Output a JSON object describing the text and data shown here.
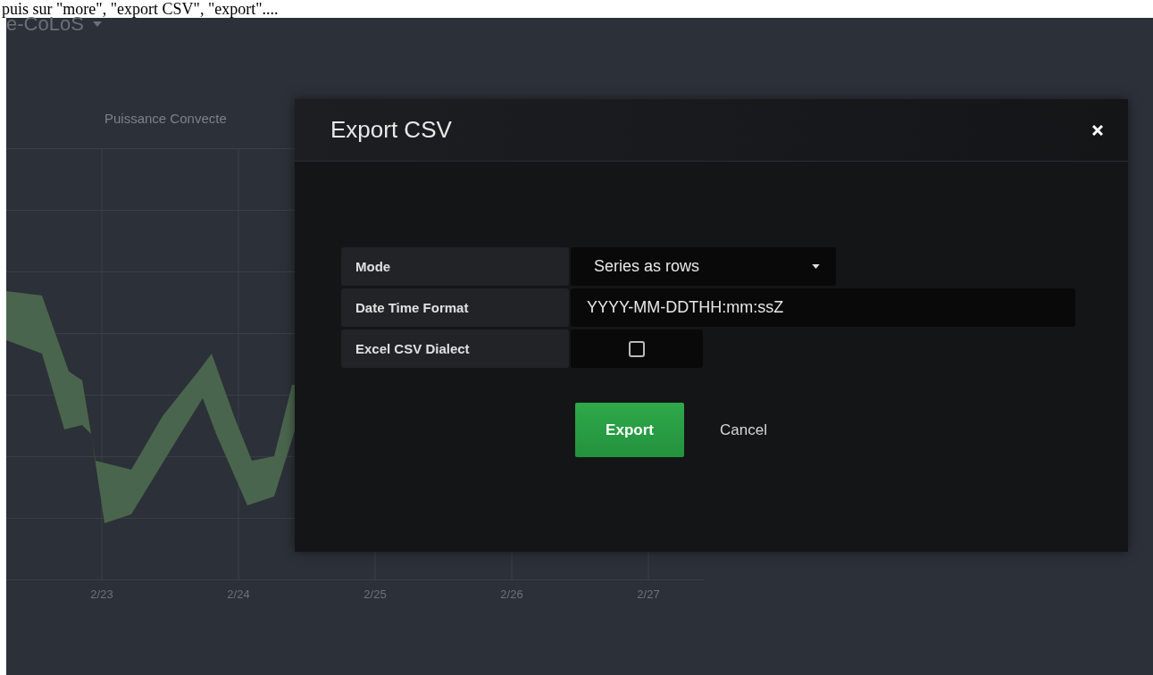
{
  "top_caption": "puis sur \"more\", \"export CSV\", \"export\"....",
  "dashboard": {
    "title": "e-CoLoS"
  },
  "panel": {
    "title": "Puissance Convecte",
    "x_labels": [
      "2/23",
      "2/24",
      "2/25",
      "2/26",
      "2/27"
    ]
  },
  "modal": {
    "title": "Export CSV",
    "fields": [
      {
        "kind": "select",
        "label": "Mode",
        "value": "Series as rows"
      },
      {
        "kind": "text",
        "label": "Date Time Format",
        "value": "YYYY-MM-DDTHH:mm:ssZ"
      },
      {
        "kind": "checkbox",
        "label": "Excel CSV Dialect",
        "checked": false
      }
    ],
    "buttons": [
      {
        "kind": "primary",
        "label": "Export"
      },
      {
        "kind": "link",
        "label": "Cancel"
      }
    ]
  }
}
